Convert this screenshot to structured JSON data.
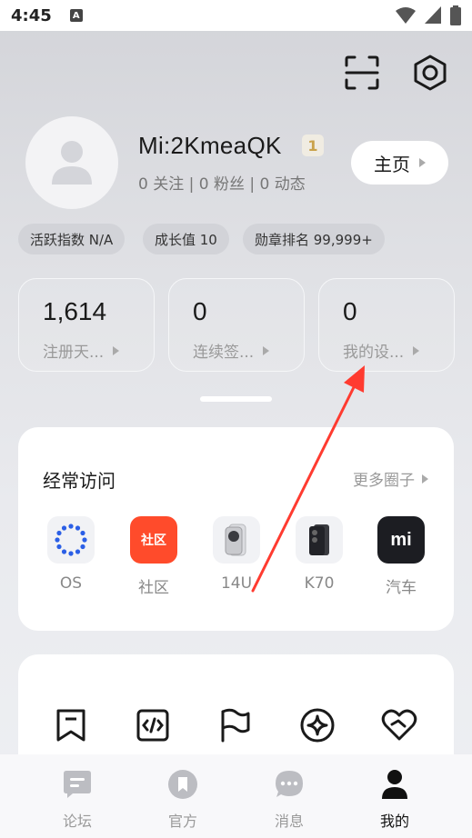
{
  "status_bar": {
    "time": "4:45",
    "notification_icon": "A"
  },
  "top_actions": {
    "scan_icon": "scan-icon",
    "settings_icon": "settings-icon"
  },
  "profile": {
    "username": "Mi:2KmeaQK",
    "level": "1",
    "follow_stats": "0 关注 | 0 粉丝 | 0 动态",
    "home_button": "主页"
  },
  "chips": [
    "活跃指数 N/A",
    "成长值 10",
    "勋章排名 99,999+"
  ],
  "stats": [
    {
      "value": "1,614",
      "label": "注册天..."
    },
    {
      "value": "0",
      "label": "连续签..."
    },
    {
      "value": "0",
      "label": "我的设..."
    }
  ],
  "frequent_visits": {
    "title": "经常访问",
    "more": "更多圈子",
    "apps": [
      {
        "label": "OS",
        "icon": "os-icon"
      },
      {
        "label": "社区",
        "icon_text": "社区"
      },
      {
        "label": "14U",
        "icon": "phone-14u-icon"
      },
      {
        "label": "K70",
        "icon": "phone-k70-icon"
      },
      {
        "label": "汽车",
        "icon_text": "mi"
      }
    ]
  },
  "tools": [
    "bookmark-icon",
    "code-icon",
    "flag-icon",
    "compass-icon",
    "heart-icon"
  ],
  "tab_bar": [
    {
      "label": "论坛",
      "active": false
    },
    {
      "label": "官方",
      "active": false
    },
    {
      "label": "消息",
      "active": false
    },
    {
      "label": "我的",
      "active": true
    }
  ],
  "colors": {
    "accent_red": "#ff3b30",
    "community_red": "#ff4b2b",
    "car_black": "#1c1d22",
    "os_blue": "#2b5fe6"
  }
}
